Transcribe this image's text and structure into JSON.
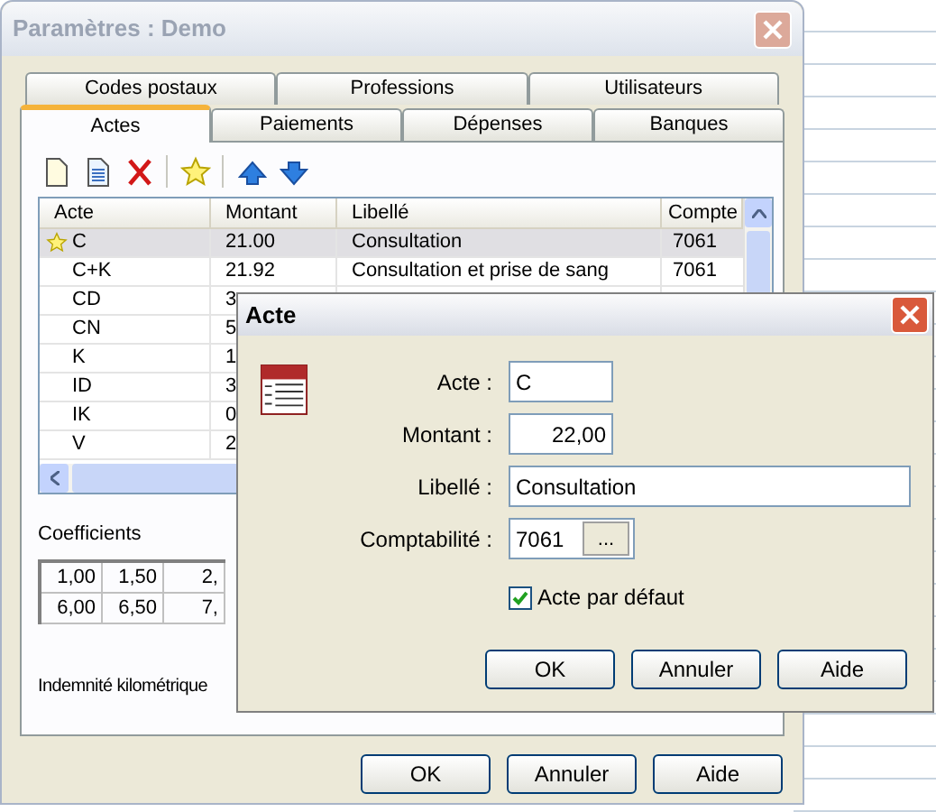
{
  "window": {
    "title": "Paramètres : Demo"
  },
  "tabs_back_row": [
    {
      "label": "Codes postaux",
      "selected": false
    },
    {
      "label": "Professions",
      "selected": false
    },
    {
      "label": "Utilisateurs",
      "selected": false
    }
  ],
  "tabs_front_row": [
    {
      "label": "Actes",
      "selected": true
    },
    {
      "label": "Paiements",
      "selected": false
    },
    {
      "label": "Dépenses",
      "selected": false
    },
    {
      "label": "Banques",
      "selected": false
    }
  ],
  "table": {
    "columns": [
      "Acte",
      "Montant",
      "Libellé",
      "Compte"
    ],
    "rows": [
      {
        "acte": "C",
        "montant": "21.00",
        "libelle": "Consultation",
        "compte": "7061",
        "selected": true,
        "default": true
      },
      {
        "acte": "C+K",
        "montant": "21.92",
        "libelle": "Consultation et prise de sang",
        "compte": "7061",
        "selected": false,
        "default": false
      },
      {
        "acte": "CD",
        "montant": "3",
        "selected": false,
        "default": false
      },
      {
        "acte": "CN",
        "montant": "5",
        "selected": false,
        "default": false
      },
      {
        "acte": "K",
        "montant": "1",
        "selected": false,
        "default": false
      },
      {
        "acte": "ID",
        "montant": "3",
        "selected": false,
        "default": false
      },
      {
        "acte": "IK",
        "montant": "0",
        "selected": false,
        "default": false
      },
      {
        "acte": "V",
        "montant": "2",
        "selected": false,
        "default": false
      }
    ]
  },
  "coefficients": {
    "label": "Coefficients",
    "rows": [
      [
        "1,00",
        "1,50",
        "2,"
      ],
      [
        "6,00",
        "6,50",
        "7,"
      ]
    ]
  },
  "indemnite": "Indemnité kilométrique",
  "buttons": [
    "OK",
    "Annuler",
    "Aide"
  ],
  "dialog": {
    "title": "Acte",
    "fields": [
      {
        "kind": "short",
        "label": "Acte :",
        "value": "C"
      },
      {
        "kind": "amount",
        "label": "Montant :",
        "value": "22,00"
      },
      {
        "kind": "wide",
        "label": "Libellé :",
        "value": "Consultation"
      },
      {
        "kind": "lookup",
        "label": "Comptabilité :",
        "value": "7061",
        "button": "..."
      }
    ],
    "checkbox": {
      "label": "Acte par défaut",
      "checked": true
    },
    "buttons": [
      "OK",
      "Annuler",
      "Aide"
    ]
  }
}
